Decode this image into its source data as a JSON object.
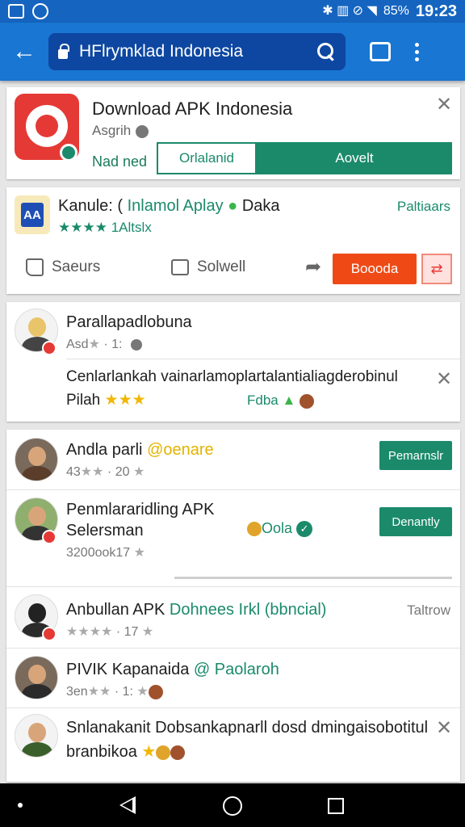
{
  "status_bar": {
    "time": "19:23",
    "battery": "85%",
    "signal_glyphs": "✱ ▥ ⊘ ◥"
  },
  "toolbar": {
    "url": "HFlrymklad Indonesia"
  },
  "app_card": {
    "title": "Download APK Indonesia",
    "subtitle": "Asgrih",
    "note": "Nad ned",
    "outline_button": "Orlalanid",
    "primary_button": "Aovelt"
  },
  "post_card": {
    "title_black": "Kanule: (",
    "title_green": "Inlamol Aplay",
    "title_tail": "Daka",
    "right_label": "Paltiaars",
    "rating_count": "1Altslx",
    "actions": {
      "like": "Saeurs",
      "comment": "Solwell",
      "primary": "Boooda",
      "icon_button": "⇄"
    }
  },
  "comment_card": {
    "author": "Parallapadlobuna",
    "meta": "Asd",
    "meta_tail": "1:",
    "body": "Cenlarlankah vainarlamoplartalantialiagderobinul",
    "body2": "Pilah",
    "tag": "Fdba"
  },
  "list": [
    {
      "name": "Andla parli",
      "highlight": "@oenare",
      "meta": "43",
      "meta_tail": "20",
      "button": "Pemarnslr"
    },
    {
      "name": "Penmlararidling APK",
      "name2": "Selersman",
      "extra": "Oola",
      "meta": "3200ook17",
      "button": "Denantly"
    },
    {
      "name": "Anbullan APK",
      "highlight": "Dohnees Irkl (bbncial)",
      "right": "Taltrow",
      "meta": "17"
    },
    {
      "name": "PIVIK Kapanaida",
      "highlight": "@ Paolaroh",
      "meta": "3en",
      "meta_tail": "1:"
    },
    {
      "name": "Snlanakanit Dobsankapnarll dosd dmingaisobotitul",
      "name2": "branbikoa"
    }
  ],
  "colors": {
    "brand_blue": "#1976d2",
    "accent_green": "#1b8a6b",
    "accent_orange": "#ef4a16"
  }
}
